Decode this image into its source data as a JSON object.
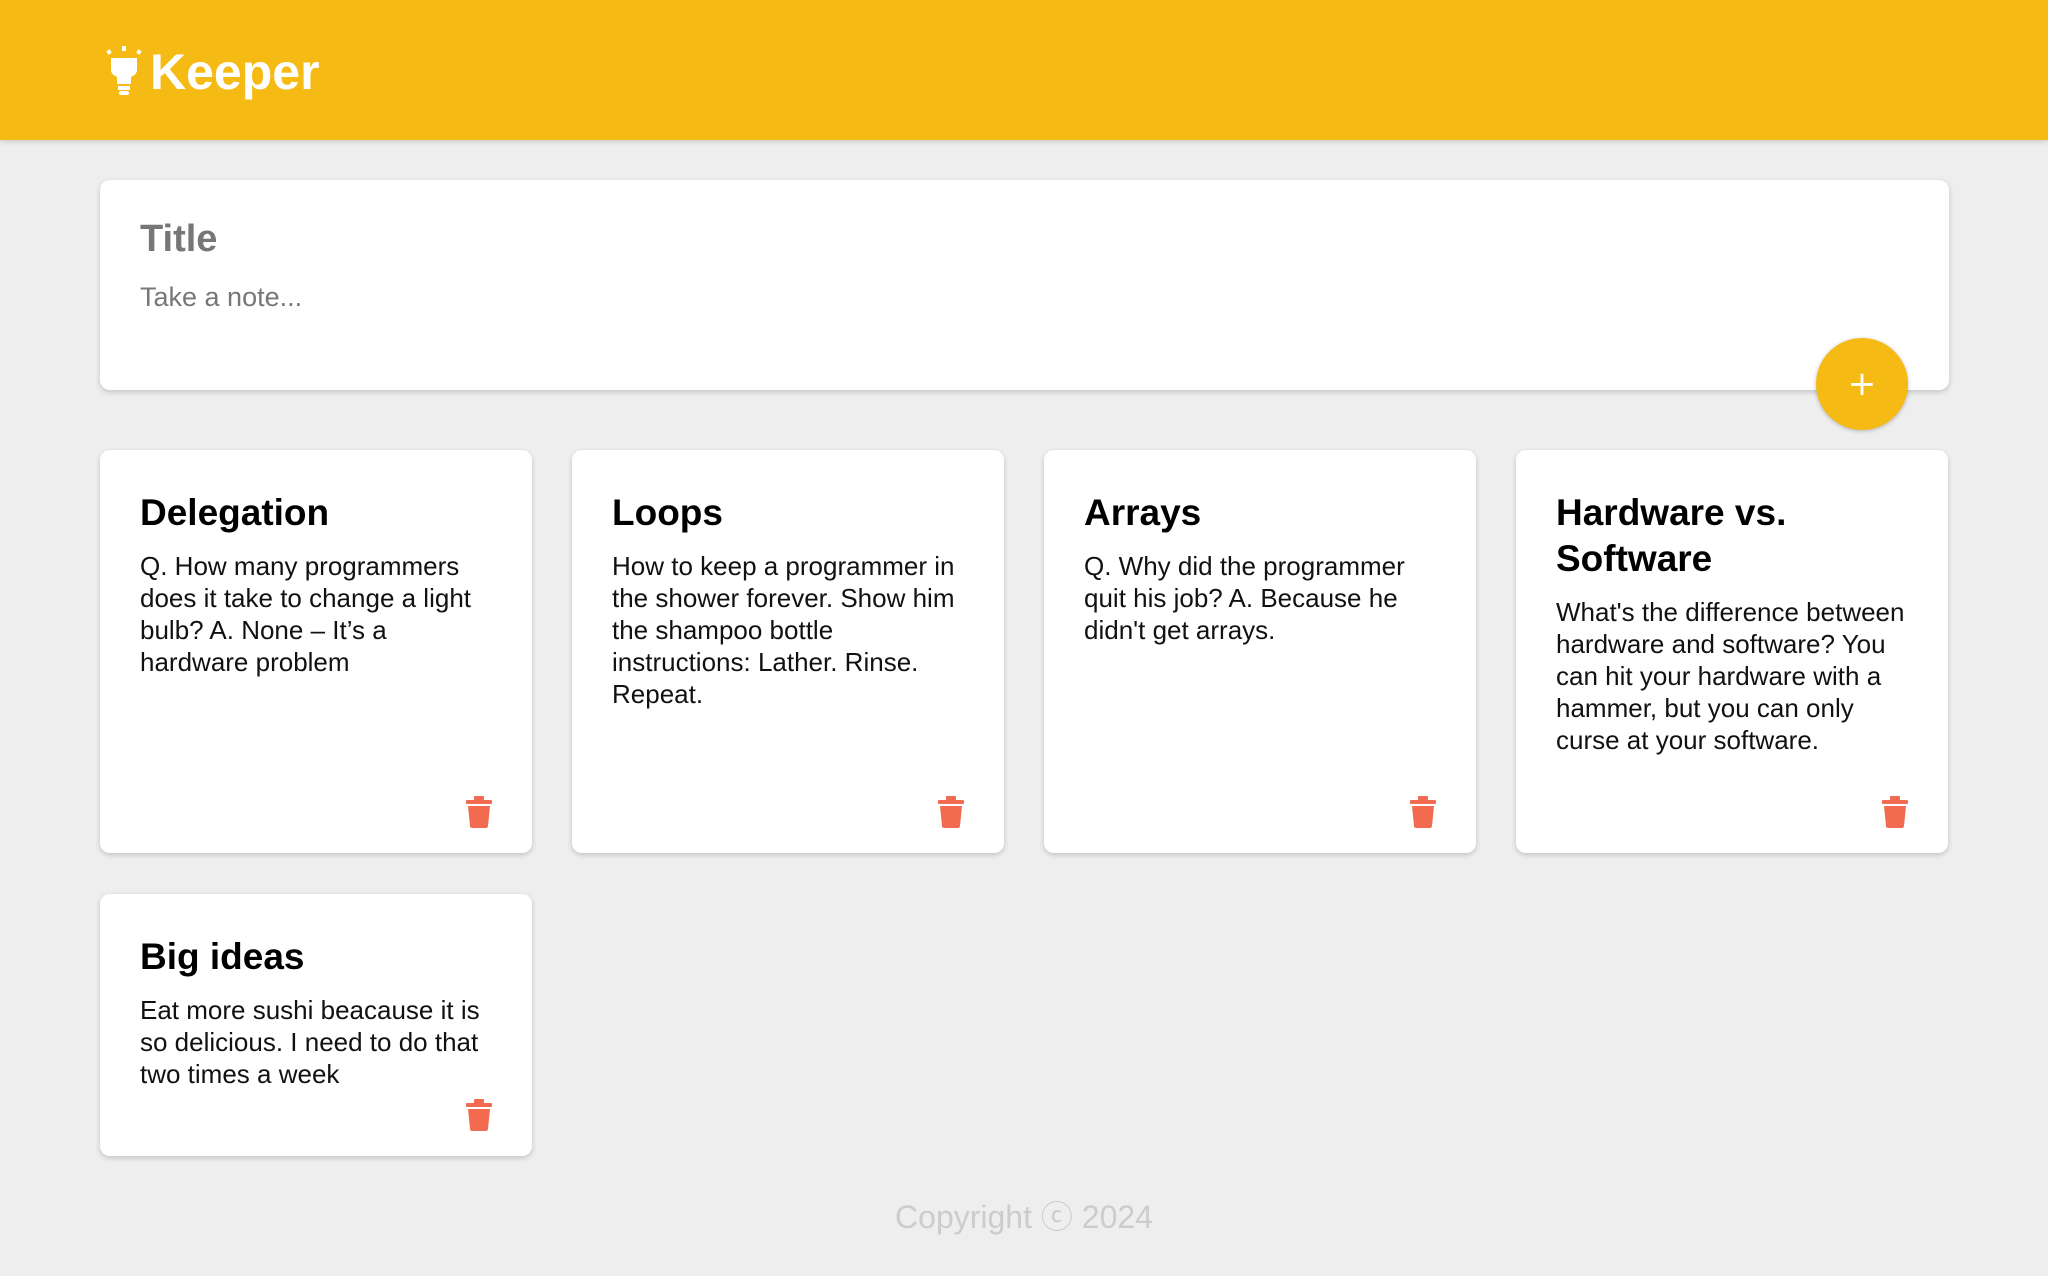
{
  "app": {
    "title": "Keeper",
    "brand_color": "#f5ba13",
    "logo_icon": "lightbulb-icon"
  },
  "composer": {
    "title_placeholder": "Title",
    "content_placeholder": "Take a note...",
    "add_button_label": "+"
  },
  "notes": [
    {
      "title": "Delegation",
      "content": "Q. How many programmers does it take to change a light bulb? A. None – It’s a hardware problem"
    },
    {
      "title": "Loops",
      "content": "How to keep a programmer in the shower forever. Show him the shampoo bottle instructions: Lather. Rinse. Repeat."
    },
    {
      "title": "Arrays",
      "content": "Q. Why did the programmer quit his job? A. Because he didn't get arrays."
    },
    {
      "title": "Hardware vs. Software",
      "content": "What's the difference between hardware and software? You can hit your hardware with a hammer, but you can only curse at your software."
    },
    {
      "title": "Big ideas",
      "content": "Eat more sushi beacause it is so delicious. I need to do that two times a week"
    }
  ],
  "delete_icon": "trash-icon",
  "delete_color": "#f26b50",
  "footer": {
    "text": "Copyright ⓒ 2024"
  }
}
